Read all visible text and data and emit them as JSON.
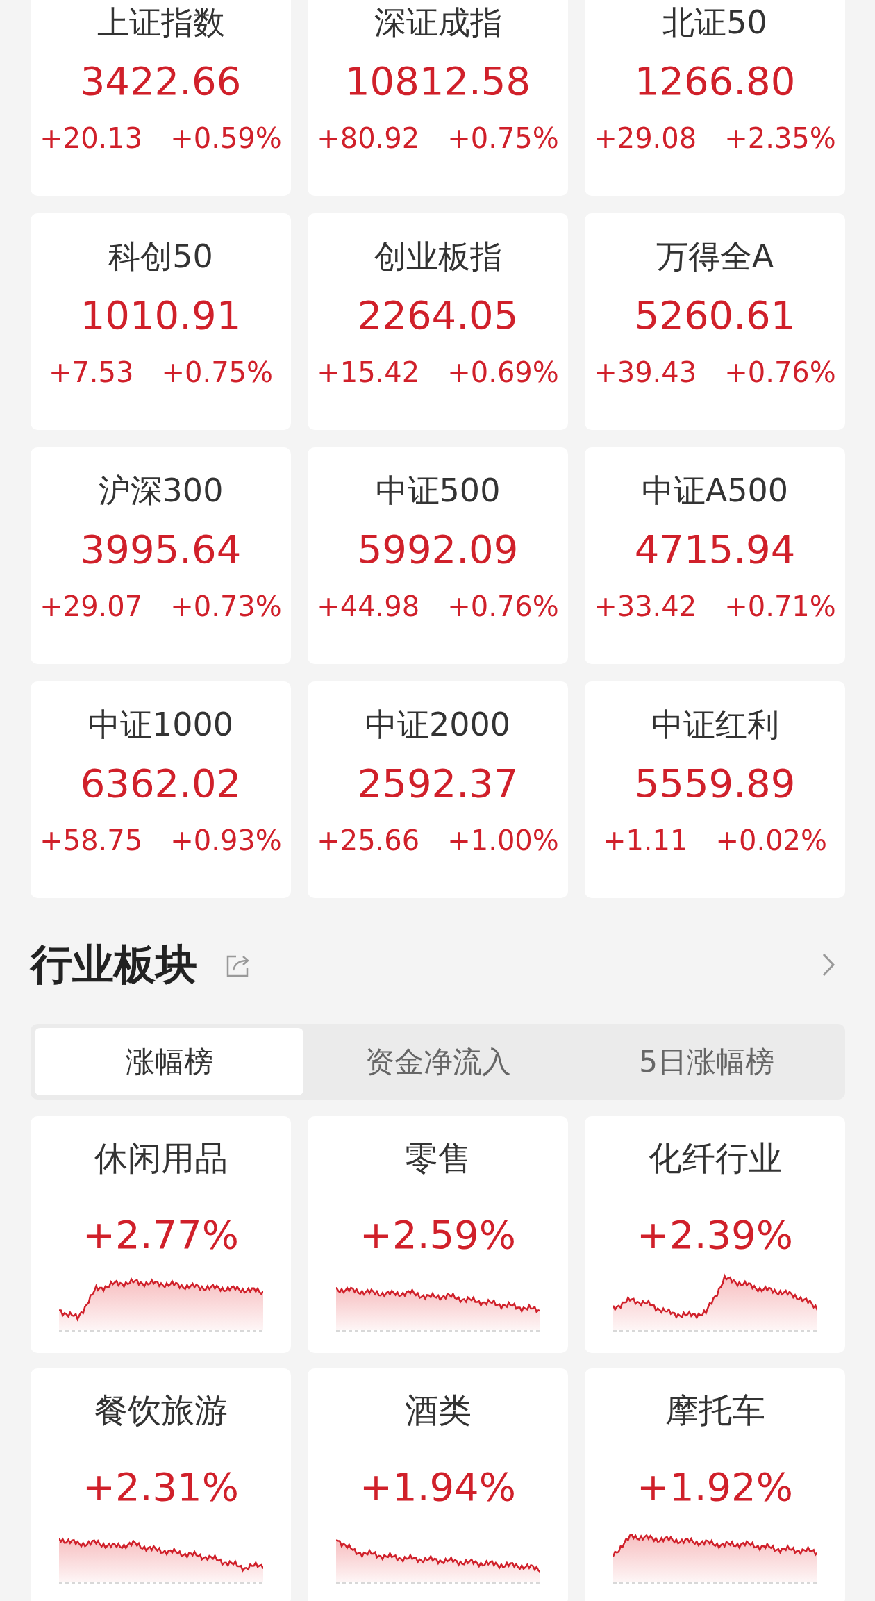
{
  "indices": [
    {
      "name": "上证指数",
      "value": "3422.66",
      "change": "+20.13",
      "percent": "+0.59%"
    },
    {
      "name": "深证成指",
      "value": "10812.58",
      "change": "+80.92",
      "percent": "+0.75%"
    },
    {
      "name": "北证50",
      "value": "1266.80",
      "change": "+29.08",
      "percent": "+2.35%"
    },
    {
      "name": "科创50",
      "value": "1010.91",
      "change": "+7.53",
      "percent": "+0.75%"
    },
    {
      "name": "创业板指",
      "value": "2264.05",
      "change": "+15.42",
      "percent": "+0.69%"
    },
    {
      "name": "万得全A",
      "value": "5260.61",
      "change": "+39.43",
      "percent": "+0.76%"
    },
    {
      "name": "沪深300",
      "value": "3995.64",
      "change": "+29.07",
      "percent": "+0.73%"
    },
    {
      "name": "中证500",
      "value": "5992.09",
      "change": "+44.98",
      "percent": "+0.76%"
    },
    {
      "name": "中证A500",
      "value": "4715.94",
      "change": "+33.42",
      "percent": "+0.71%"
    },
    {
      "name": "中证1000",
      "value": "6362.02",
      "change": "+58.75",
      "percent": "+0.93%"
    },
    {
      "name": "中证2000",
      "value": "2592.37",
      "change": "+25.66",
      "percent": "+1.00%"
    },
    {
      "name": "中证红利",
      "value": "5559.89",
      "change": "+1.11",
      "percent": "+0.02%"
    }
  ],
  "sector_section": {
    "title": "行业板块",
    "tabs": [
      {
        "label": "涨幅榜",
        "selected": true
      },
      {
        "label": "资金净流入",
        "selected": false
      },
      {
        "label": "5日涨幅榜",
        "selected": false
      }
    ],
    "sectors": [
      {
        "name": "休闲用品",
        "percent": "+2.77%"
      },
      {
        "name": "零售",
        "percent": "+2.59%"
      },
      {
        "name": "化纤行业",
        "percent": "+2.39%"
      },
      {
        "name": "餐饮旅游",
        "percent": "+2.31%"
      },
      {
        "name": "酒类",
        "percent": "+1.94%"
      },
      {
        "name": "摩托车",
        "percent": "+1.92%"
      }
    ]
  }
}
